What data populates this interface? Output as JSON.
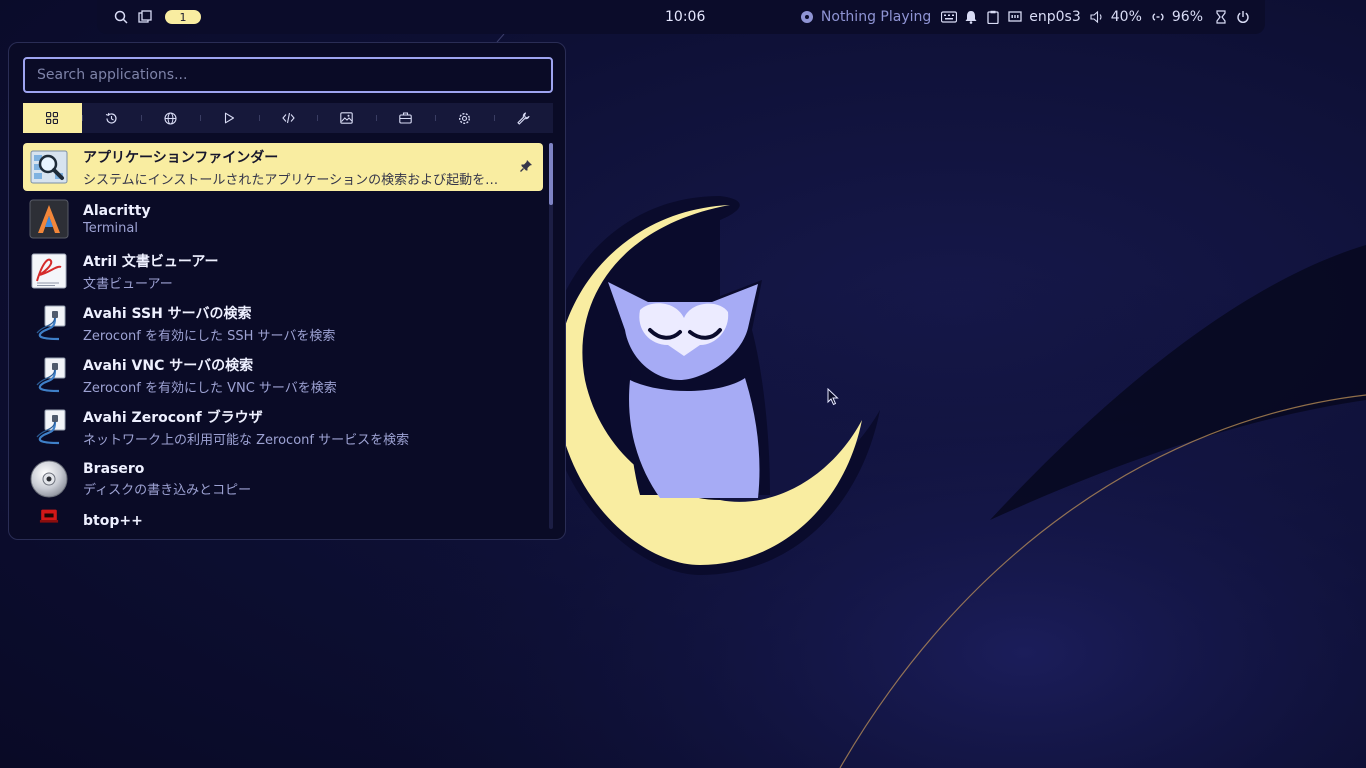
{
  "topbar": {
    "workspace_badge": "1",
    "clock": "10:06",
    "media": "Nothing Playing",
    "network": "enp0s3",
    "volume": "40%",
    "battery": "96%"
  },
  "launcher": {
    "search_placeholder": "Search applications...",
    "categories": [
      {
        "icon": "grid-icon",
        "active": true
      },
      {
        "icon": "history-icon"
      },
      {
        "icon": "globe-icon"
      },
      {
        "icon": "play-icon"
      },
      {
        "icon": "code-icon"
      },
      {
        "icon": "image-icon"
      },
      {
        "icon": "briefcase-icon"
      },
      {
        "icon": "gear-icon"
      },
      {
        "icon": "wrench-icon"
      }
    ],
    "apps": [
      {
        "name": "アプリケーションファインダー",
        "desc": "システムにインストールされたアプリケーションの検索および起動を…",
        "icon": "app-finder-icon",
        "pinned": true
      },
      {
        "name": "Alacritty",
        "desc": "Terminal",
        "icon": "alacritty-icon"
      },
      {
        "name": "Atril 文書ビューアー",
        "desc": "文書ビューアー",
        "icon": "atril-icon"
      },
      {
        "name": "Avahi SSH サーバの検索",
        "desc": "Zeroconf を有効にした SSH サーバを検索",
        "icon": "network-plug-icon"
      },
      {
        "name": "Avahi VNC サーバの検索",
        "desc": "Zeroconf を有効にした VNC サーバを検索",
        "icon": "network-plug-icon"
      },
      {
        "name": "Avahi Zeroconf ブラウザ",
        "desc": "ネットワーク上の利用可能な Zeroconf サービスを検索",
        "icon": "network-plug-icon"
      },
      {
        "name": "Brasero",
        "desc": "ディスクの書き込みとコピー",
        "icon": "disc-icon"
      },
      {
        "name": "btop++",
        "desc": "",
        "icon": "btop-icon"
      }
    ]
  },
  "colors": {
    "accent": "#f9eda1",
    "panel_bg": "#0a0b26",
    "search_border": "#9ea4f0",
    "owl": "#a6abf5",
    "moon": "#f9eda1"
  }
}
